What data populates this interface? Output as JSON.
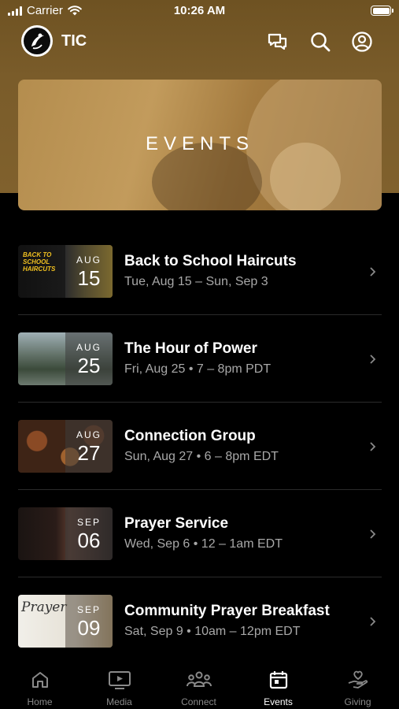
{
  "status_bar": {
    "carrier": "Carrier",
    "time": "10:26 AM",
    "battery_level": 1.0
  },
  "header": {
    "app_name": "TIC",
    "icons": [
      "logo-icon",
      "chat-icon",
      "search-icon",
      "account-icon"
    ]
  },
  "banner": {
    "title": "EVENTS"
  },
  "events": [
    {
      "title": "Back to School Haircuts",
      "subtitle": "Tue, Aug 15 – Sun, Sep 3",
      "month": "AUG",
      "day": "15",
      "thumb_text": "BACK TO SCHOOL HAIRCUTS"
    },
    {
      "title": "The Hour of Power",
      "subtitle": "Fri, Aug 25 • 7 – 8pm PDT",
      "month": "AUG",
      "day": "25"
    },
    {
      "title": "Connection Group",
      "subtitle": "Sun, Aug 27 • 6 – 8pm EDT",
      "month": "AUG",
      "day": "27"
    },
    {
      "title": "Prayer Service",
      "subtitle": "Wed, Sep 6 • 12 – 1am EDT",
      "month": "SEP",
      "day": "06"
    },
    {
      "title": "Community Prayer Breakfast",
      "subtitle": "Sat, Sep 9 • 10am – 12pm EDT",
      "month": "SEP",
      "day": "09",
      "thumb_text": "Prayer"
    }
  ],
  "tabs": [
    {
      "label": "Home",
      "icon": "home-icon"
    },
    {
      "label": "Media",
      "icon": "media-icon"
    },
    {
      "label": "Connect",
      "icon": "people-icon"
    },
    {
      "label": "Events",
      "icon": "calendar-icon",
      "active": true
    },
    {
      "label": "Giving",
      "icon": "giving-icon"
    }
  ],
  "colors": {
    "header_brown": "#7a5c2a",
    "background": "#000000",
    "inactive_tab": "#8a8a8a",
    "subtitle_gray": "#a8a8a8"
  }
}
